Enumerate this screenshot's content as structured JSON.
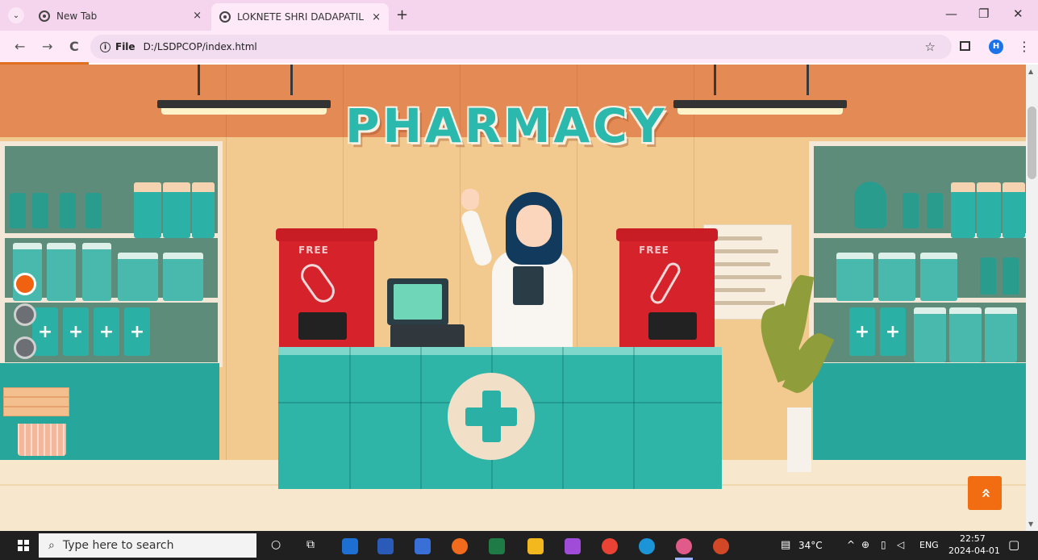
{
  "browser": {
    "tabs": [
      {
        "title": "New Tab",
        "active": false
      },
      {
        "title": "LOKNETE SHRI DADAPATIL PHA",
        "active": true
      }
    ],
    "close_glyph": "×",
    "new_tab_glyph": "+",
    "window_controls": {
      "minimize": "—",
      "restore": "❐",
      "close": "✕"
    },
    "nav": {
      "back": "←",
      "forward": "→",
      "reload": "C"
    },
    "address": {
      "scheme_label": "File",
      "url": "D:/LSDPCOP/index.html"
    },
    "profile_initial": "H",
    "bookmark_glyph": "☆",
    "menu_glyph": "⋮"
  },
  "page": {
    "sign_text": "PHARMACY",
    "dispenser_labels": [
      "FREE",
      "FREE"
    ],
    "carousel": {
      "slides": 3,
      "active_index": 0
    },
    "back_to_top_glyph": "»"
  },
  "taskbar": {
    "search_placeholder": "Type here to search",
    "weather": "34°C",
    "language": "ENG",
    "time": "22:57",
    "date": "2024-04-01"
  },
  "icons": {
    "tab_favicon": "globe-icon",
    "search": "magnifier-icon",
    "start": "windows-logo-icon",
    "back_to_top": "double-chevron-up-icon"
  },
  "colors": {
    "accent": "#f26d12",
    "brand_teal": "#2bb1a6",
    "tabstrip": "#f5d4ee",
    "toolbar": "#fde9f8",
    "taskbar": "#202020"
  }
}
